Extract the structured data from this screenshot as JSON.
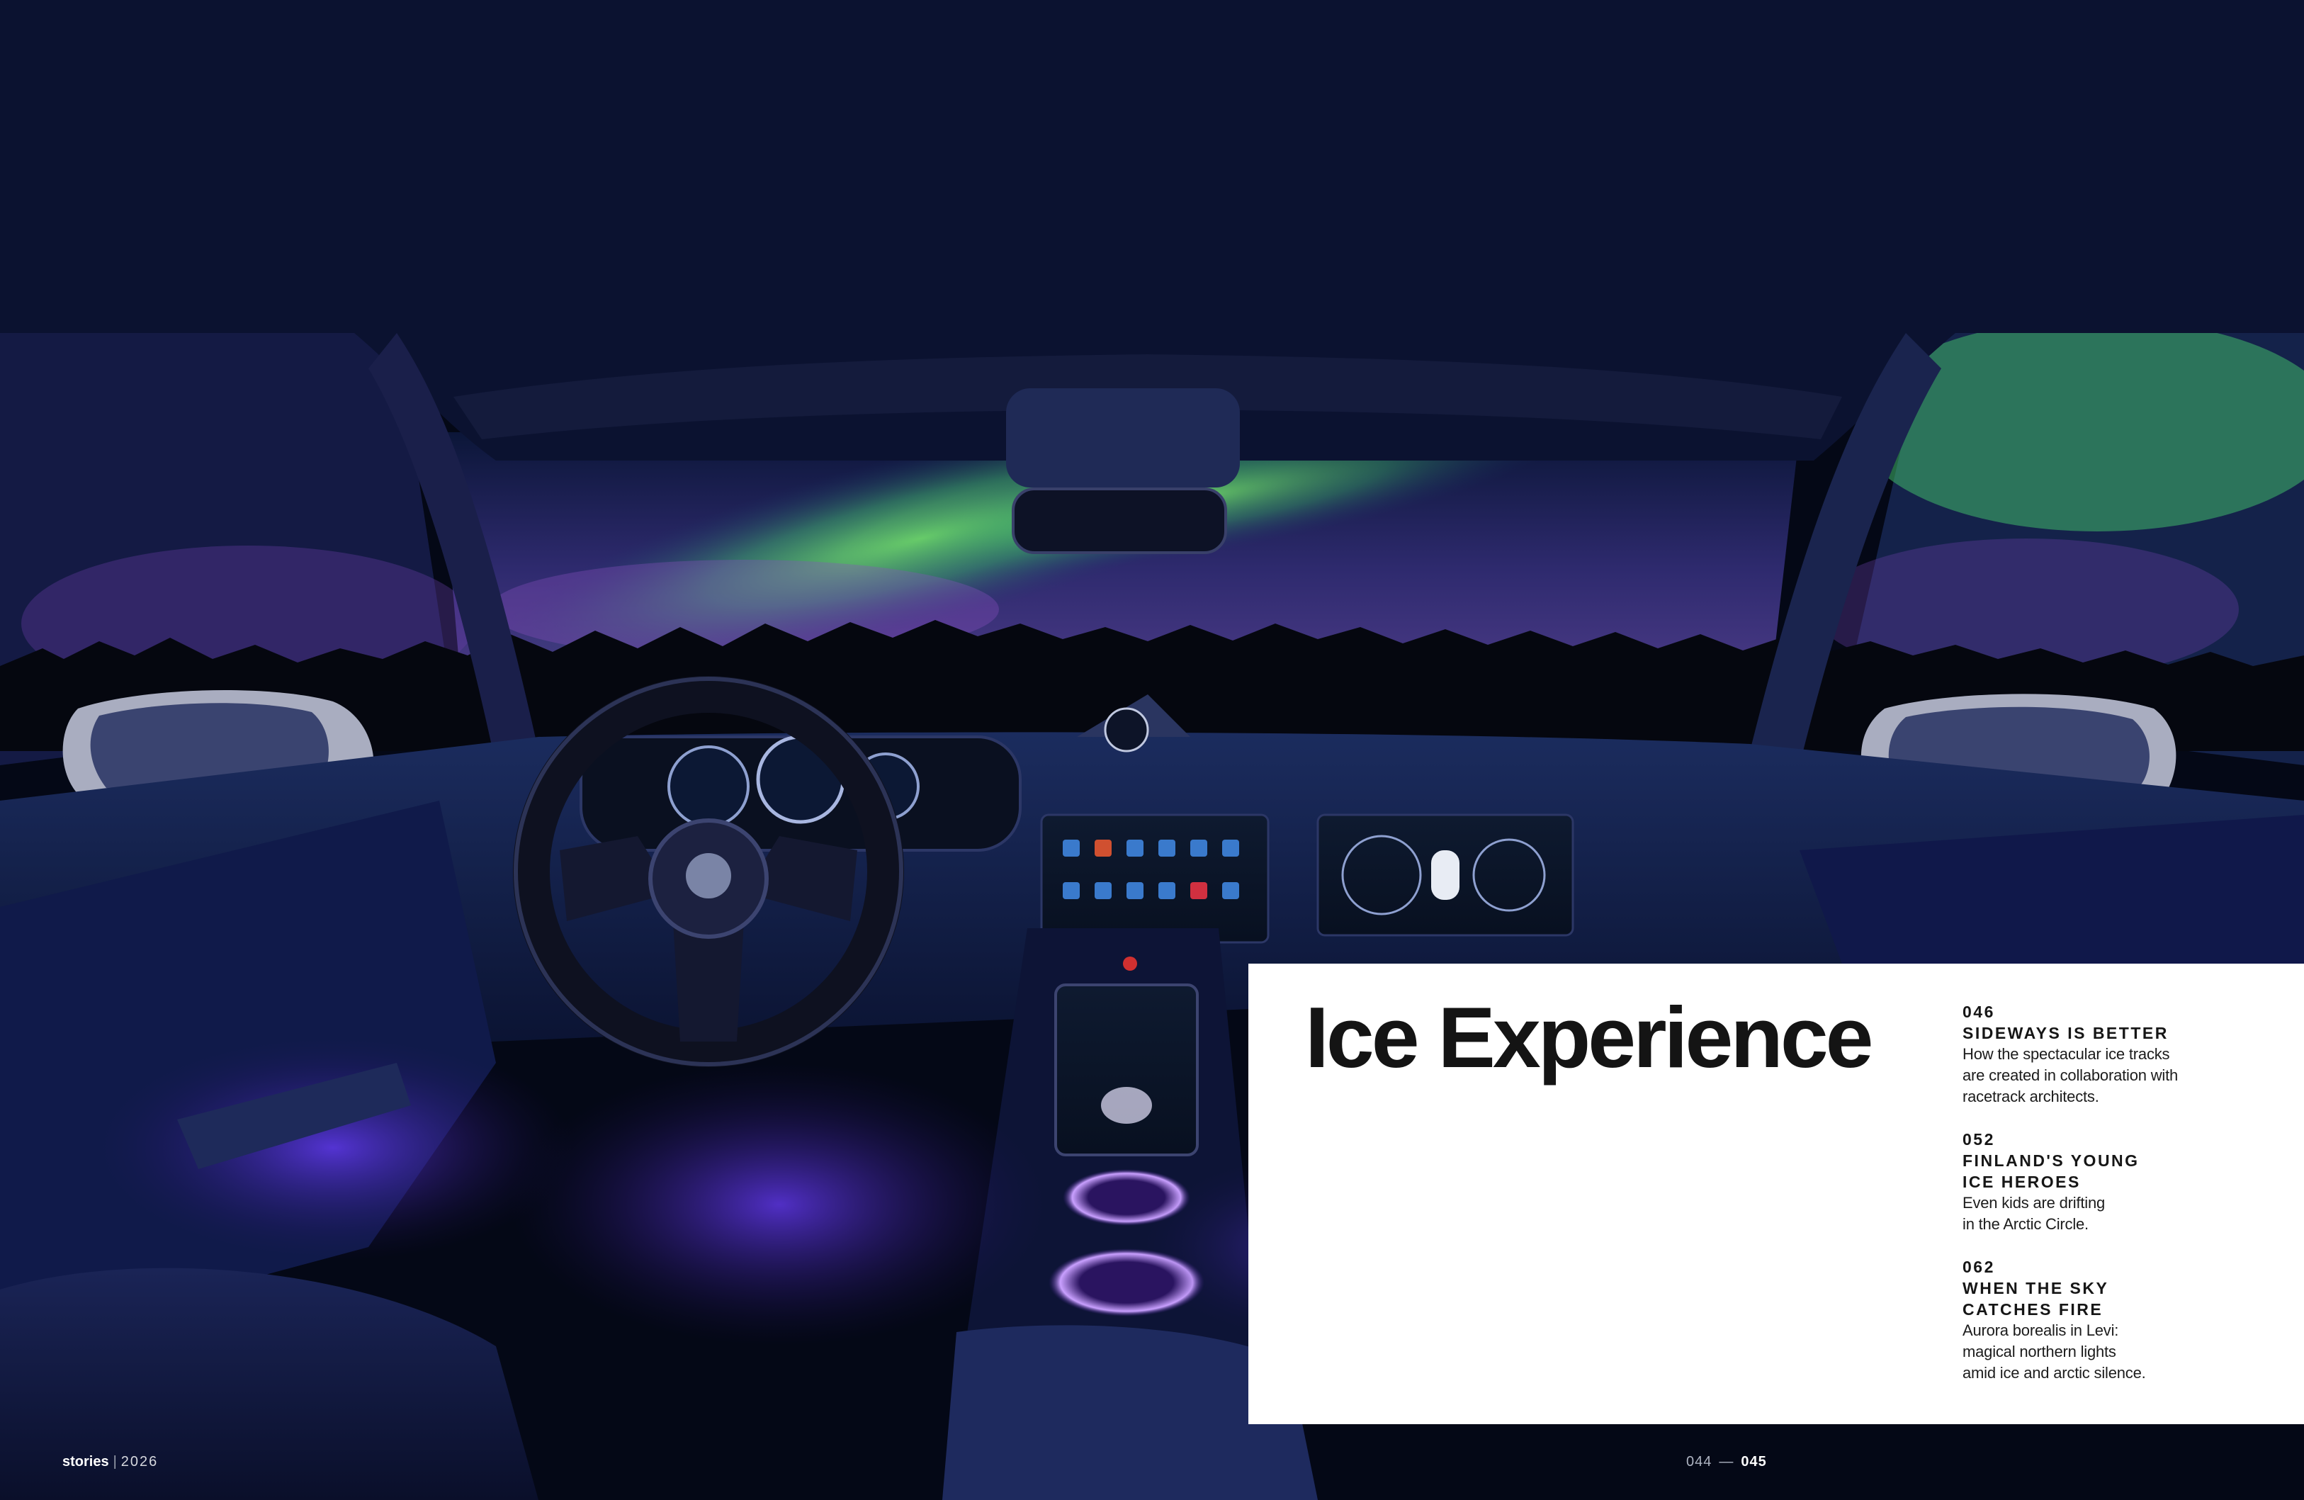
{
  "feature": {
    "title": "Ice Experience"
  },
  "toc": [
    {
      "page": "046",
      "headline_lines": [
        "SIDEWAYS IS BETTER"
      ],
      "description_lines": [
        "How the spectacular ice tracks",
        "are created in collaboration with",
        "racetrack architects."
      ]
    },
    {
      "page": "052",
      "headline_lines": [
        "FINLAND'S YOUNG",
        "ICE HEROES"
      ],
      "description_lines": [
        "Even kids are drifting",
        "in the Arctic Circle."
      ]
    },
    {
      "page": "062",
      "headline_lines": [
        "WHEN THE SKY",
        "CATCHES FIRE"
      ],
      "description_lines": [
        "Aurora borealis in Levi:",
        "magical northern lights",
        "amid ice and arctic silence."
      ]
    }
  ],
  "footer": {
    "magazine": "stories",
    "separator": "|",
    "year": "2026",
    "page_left": "044",
    "dash": "—",
    "page_right": "045"
  },
  "colors": {
    "night_sky": "#050a1a",
    "aurora_green": "#5fd65a",
    "aurora_purple": "#7a4fb0",
    "ambient_light": "#7b4dff",
    "panel": "#ffffff",
    "text_dark": "#141414"
  }
}
